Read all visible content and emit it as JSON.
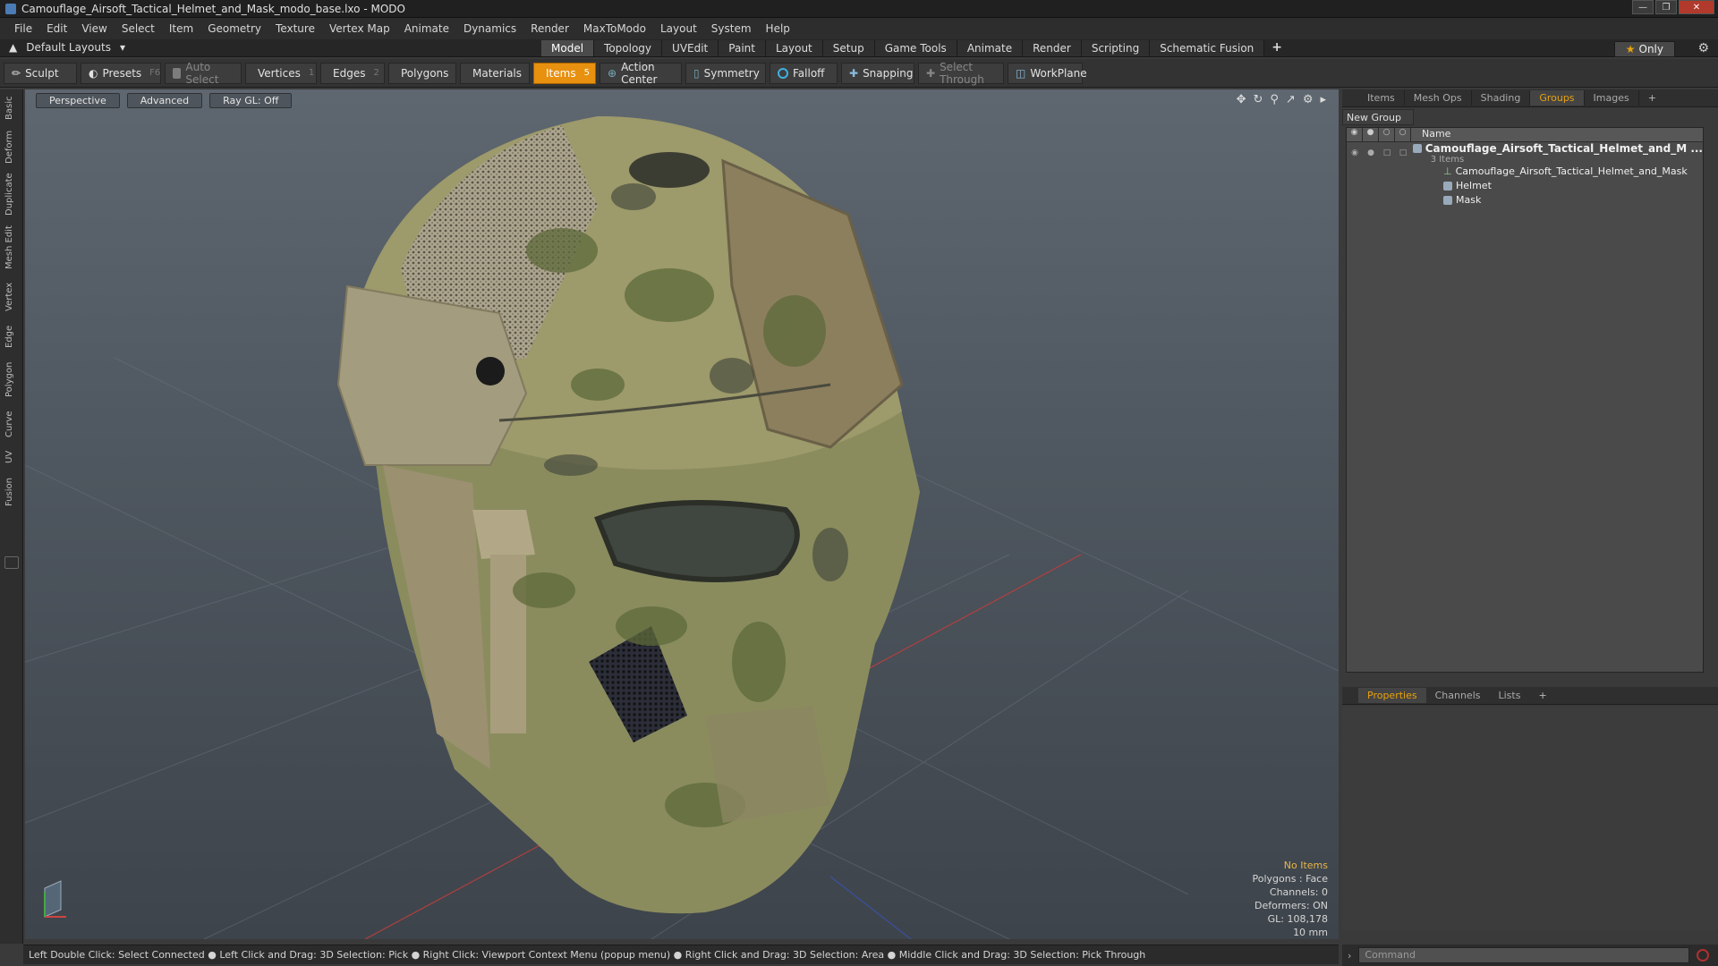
{
  "window": {
    "title": "Camouflage_Airsoft_Tactical_Helmet_and_Mask_modo_base.lxo - MODO"
  },
  "menu": [
    "File",
    "Edit",
    "View",
    "Select",
    "Item",
    "Geometry",
    "Texture",
    "Vertex Map",
    "Animate",
    "Dynamics",
    "Render",
    "MaxToModo",
    "Layout",
    "System",
    "Help"
  ],
  "layout": {
    "default_layouts": "Default Layouts",
    "tabs": [
      "Model",
      "Topology",
      "UVEdit",
      "Paint",
      "Layout",
      "Setup",
      "Game Tools",
      "Animate",
      "Render",
      "Scripting",
      "Schematic Fusion"
    ],
    "active_tab": "Model",
    "only_label": "Only"
  },
  "toolbar": {
    "sculpt": "Sculpt",
    "presets": "Presets",
    "presets_key": "F6",
    "auto_select": "Auto Select",
    "vertices": "Vertices",
    "vertices_count": "1",
    "edges": "Edges",
    "edges_count": "2",
    "polygons": "Polygons",
    "materials": "Materials",
    "items": "Items",
    "items_count": "5",
    "action_center": "Action Center",
    "symmetry": "Symmetry",
    "falloff": "Falloff",
    "snapping": "Snapping",
    "select_through": "Select Through",
    "workplane": "WorkPlane"
  },
  "left_tabs": [
    "Basic",
    "Deform",
    "Duplicate",
    "Mesh Edit",
    "Vertex",
    "Edge",
    "Polygon",
    "Curve",
    "UV",
    "Fusion"
  ],
  "viewport": {
    "view": "Perspective",
    "shading": "Advanced",
    "raygl": "Ray GL: Off",
    "info": {
      "no_items": "No Items",
      "polygons": "Polygons : Face",
      "channels": "Channels: 0",
      "deformers": "Deformers: ON",
      "gl": "GL: 108,178",
      "scale": "10 mm"
    }
  },
  "item_panel": {
    "tabs": [
      "Items",
      "Mesh Ops",
      "Shading",
      "Groups",
      "Images"
    ],
    "active_tab": "Groups",
    "new_group": "New Group",
    "name_header": "Name",
    "group_name": "Camouflage_Airsoft_Tactical_Helmet_and_M ...",
    "group_count": "3 Items",
    "children": [
      "Camouflage_Airsoft_Tactical_Helmet_and_Mask",
      "Helmet",
      "Mask"
    ]
  },
  "props_panel": {
    "tabs": [
      "Properties",
      "Channels",
      "Lists"
    ],
    "active_tab": "Properties"
  },
  "status": {
    "hints": "Left Double Click: Select Connected ● Left Click and Drag: 3D Selection: Pick ● Right Click: Viewport Context Menu (popup menu) ● Right Click and Drag: 3D Selection: Area ● Middle Click and Drag: 3D Selection: Pick Through"
  },
  "command": {
    "placeholder": "Command"
  },
  "colors": {
    "accent": "#e8900f",
    "active_tab_text": "#e8a20e",
    "viewport_top": "#5e6770",
    "viewport_bottom": "#3e444b"
  }
}
